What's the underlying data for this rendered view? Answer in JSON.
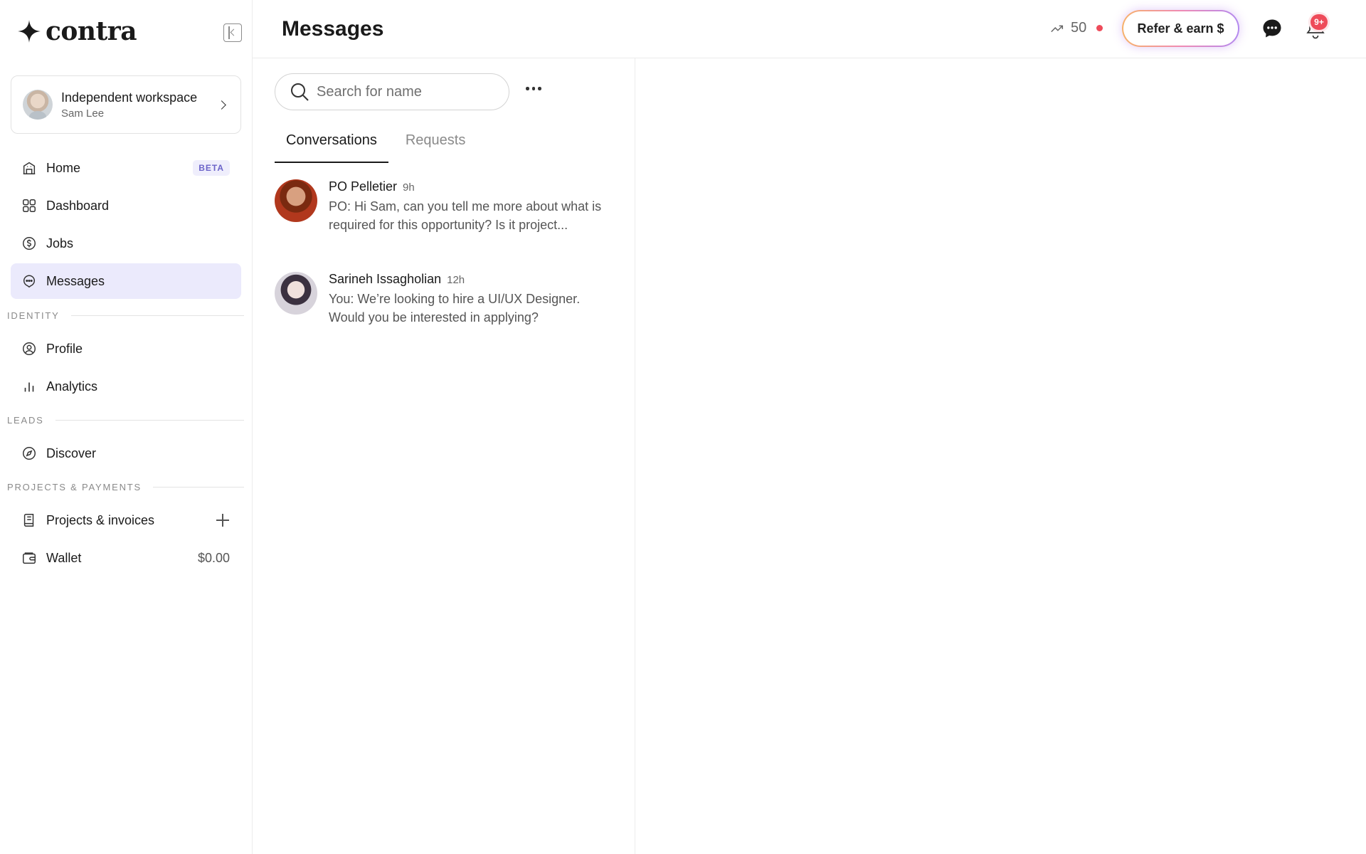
{
  "brand": {
    "name": "contra"
  },
  "workspace": {
    "title": "Independent workspace",
    "user": "Sam Lee"
  },
  "nav": {
    "home": {
      "label": "Home",
      "badge": "BETA"
    },
    "dashboard": {
      "label": "Dashboard"
    },
    "jobs": {
      "label": "Jobs"
    },
    "messages": {
      "label": "Messages"
    },
    "identity_label": "IDENTITY",
    "profile": {
      "label": "Profile"
    },
    "analytics": {
      "label": "Analytics"
    },
    "leads_label": "LEADS",
    "discover": {
      "label": "Discover"
    },
    "projects_label": "PROJECTS & PAYMENTS",
    "projects": {
      "label": "Projects & invoices"
    },
    "wallet": {
      "label": "Wallet",
      "amount": "$0.00"
    }
  },
  "header": {
    "title": "Messages",
    "streak_value": "50",
    "refer_label": "Refer & earn $",
    "notification_count": "9+"
  },
  "search": {
    "placeholder": "Search for name",
    "value": ""
  },
  "tabs": {
    "conversations": "Conversations",
    "requests": "Requests",
    "active": "Conversations"
  },
  "conversations": [
    {
      "name": "PO Pelletier",
      "time": "9h",
      "preview": "PO: Hi Sam, can you tell me more about what is required for this opportunity? Is it project..."
    },
    {
      "name": "Sarineh Issagholian",
      "time": "12h",
      "preview": "You: We’re looking to hire a UI/UX Designer. Would you be interested in applying?"
    }
  ],
  "colors": {
    "accent_bg": "#ebeafc",
    "badge_text": "#6b63c9",
    "notification": "#ee4b5a"
  }
}
